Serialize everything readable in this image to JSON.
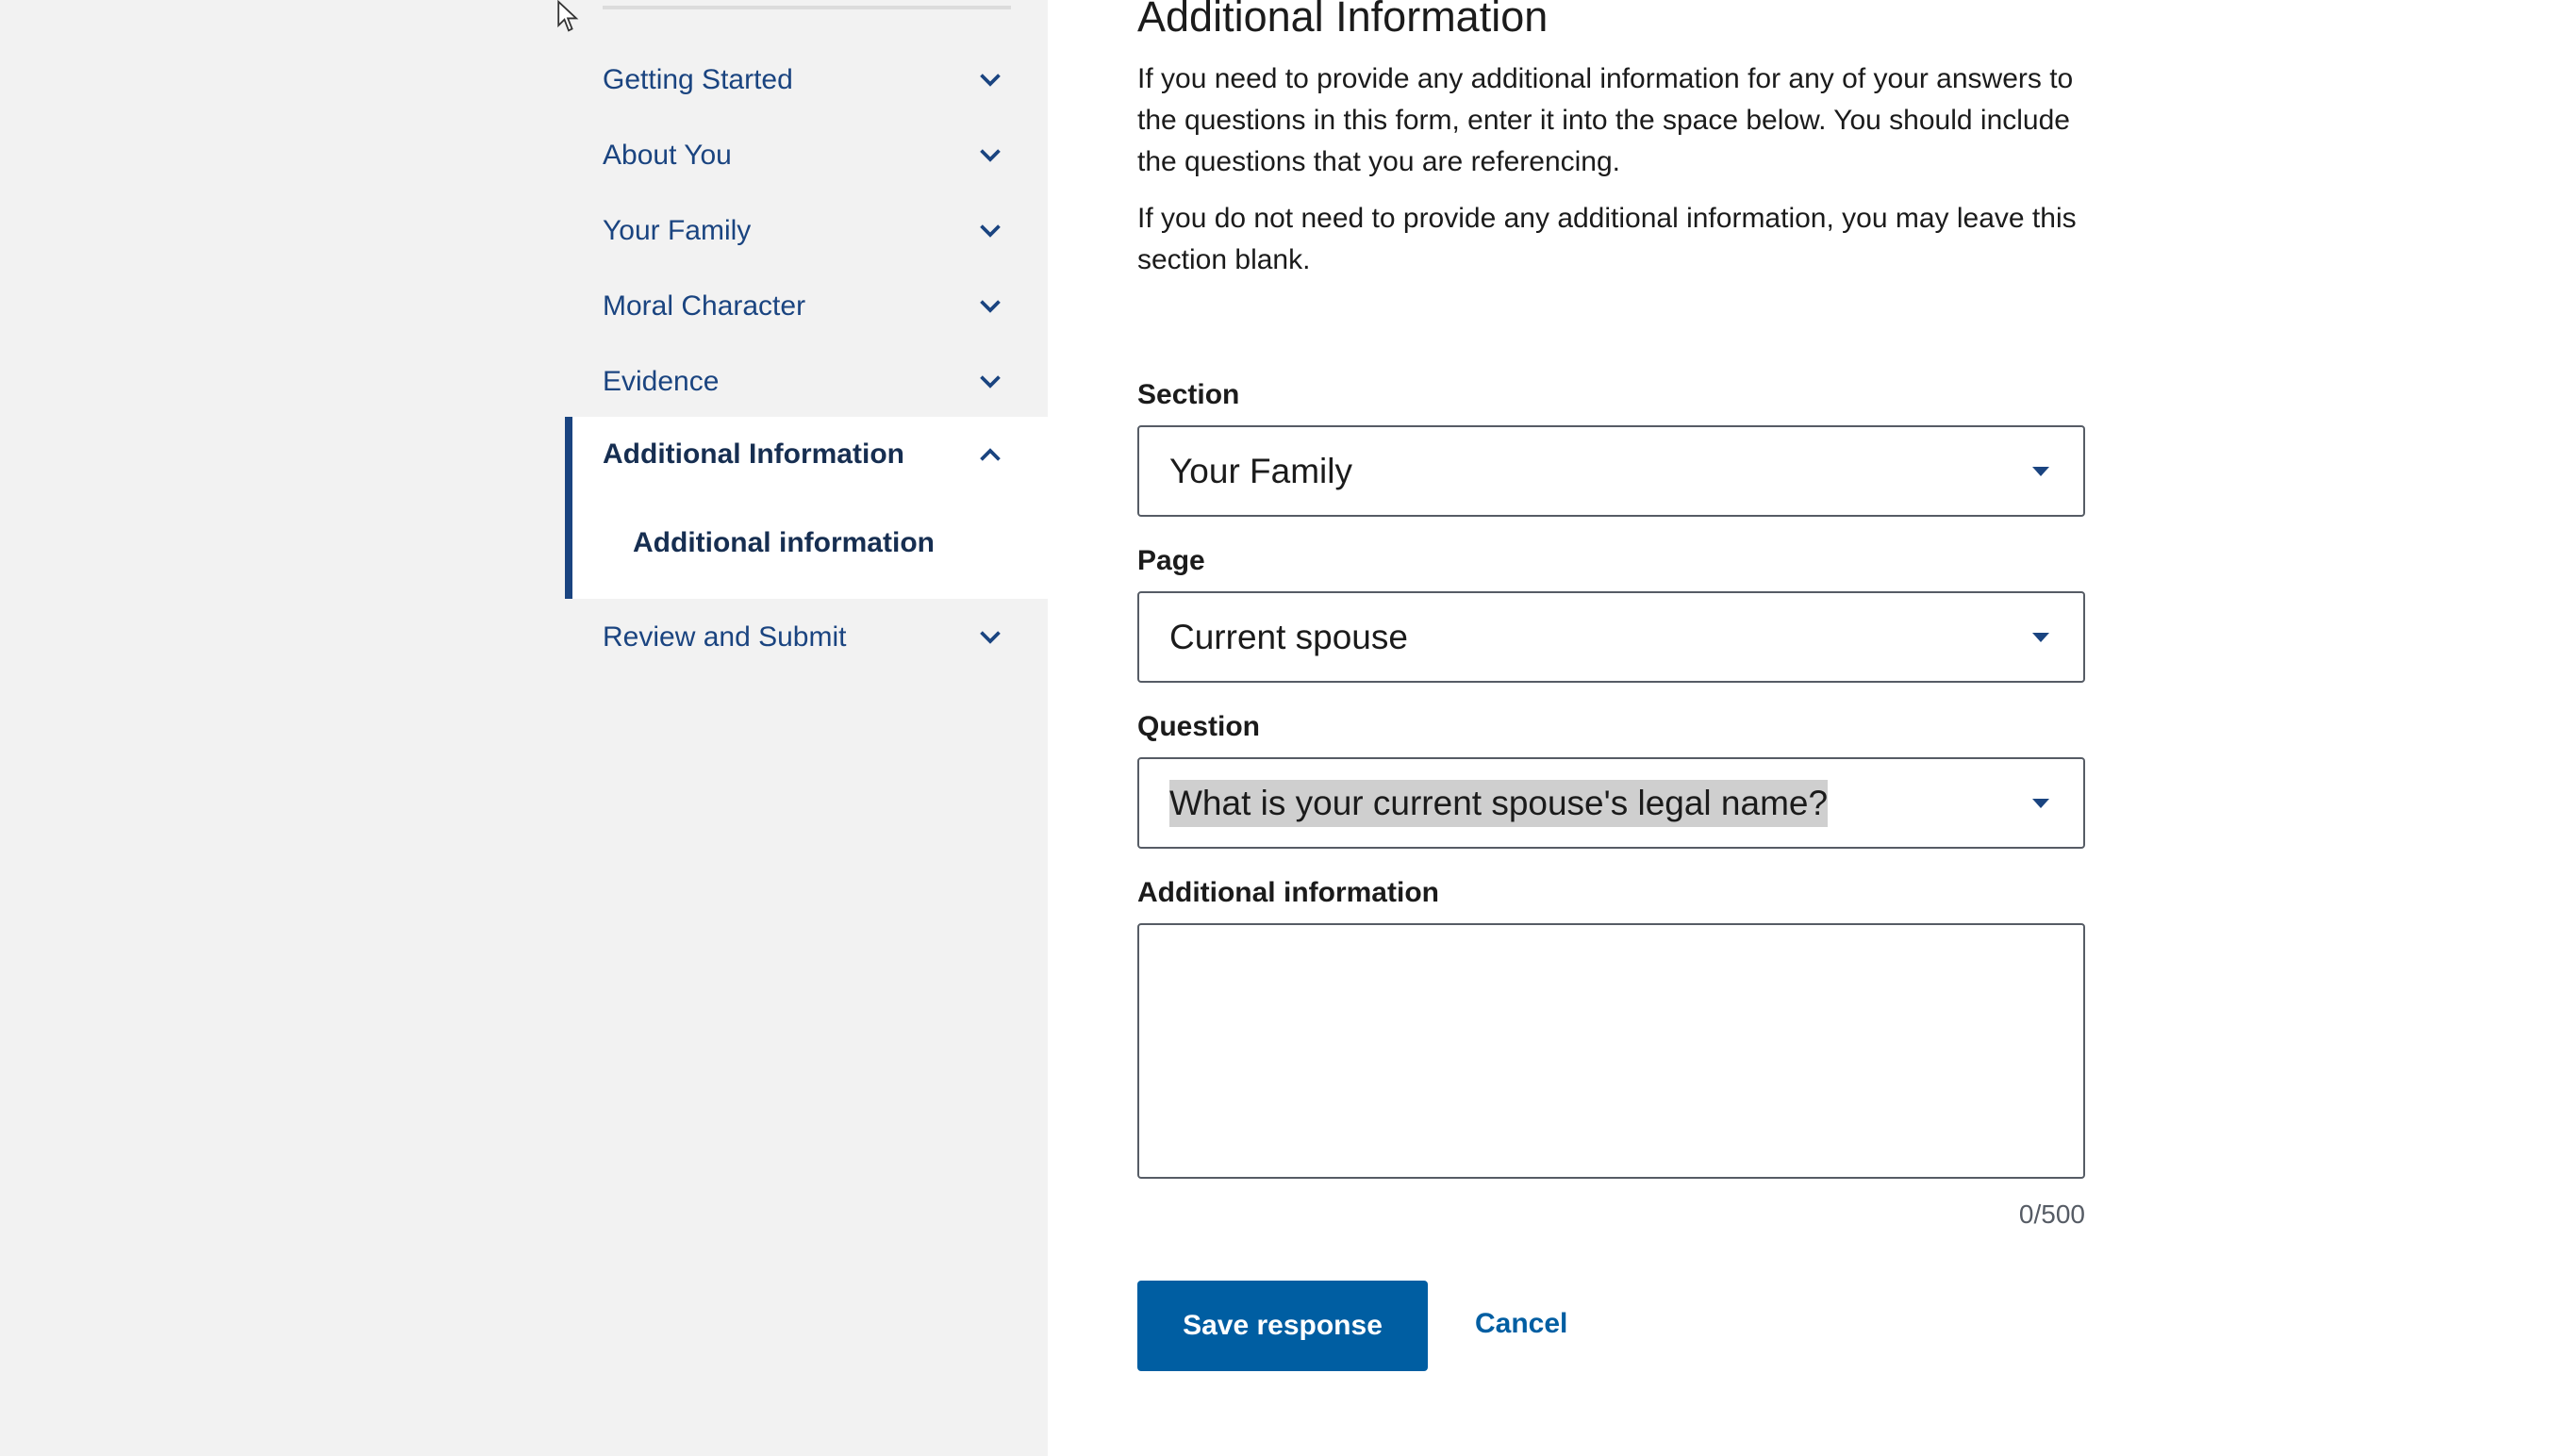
{
  "sidenav": {
    "items": [
      {
        "label": "Getting Started",
        "icon": "chevron-down-icon"
      },
      {
        "label": "About You",
        "icon": "chevron-down-icon"
      },
      {
        "label": "Your Family",
        "icon": "chevron-down-icon"
      },
      {
        "label": "Moral Character",
        "icon": "chevron-down-icon"
      },
      {
        "label": "Evidence",
        "icon": "chevron-down-icon"
      },
      {
        "label": "Additional Information",
        "icon": "chevron-up-icon",
        "active": true,
        "subitems": [
          {
            "label": "Additional information"
          }
        ]
      },
      {
        "label": "Review and Submit",
        "icon": "chevron-down-icon"
      }
    ]
  },
  "main": {
    "title": "Additional Information",
    "intro_1": "If you need to provide any additional information for any of your answers to the questions in this form, enter it into the space below. You should include the questions that you are referencing.",
    "intro_2": "If you do not need to provide any additional information, you may leave this section blank.",
    "section": {
      "label": "Section",
      "value": "Your Family"
    },
    "page": {
      "label": "Page",
      "value": "Current spouse"
    },
    "question": {
      "label": "Question",
      "value": "What is your current spouse's legal name?"
    },
    "additional_info": {
      "label": "Additional information",
      "value": "",
      "counter": "0/500"
    },
    "save_label": "Save response",
    "cancel_label": "Cancel"
  },
  "colors": {
    "nav_link": "#1a4480",
    "nav_active": "#162e51",
    "primary_button": "#005ea2",
    "sidebar_bg": "#f2f2f2"
  }
}
